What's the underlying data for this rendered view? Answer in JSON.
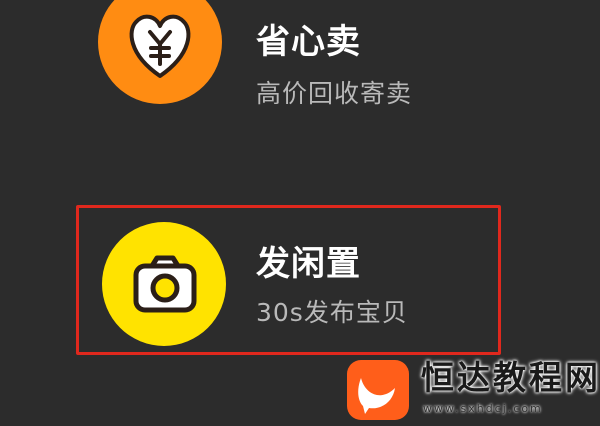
{
  "menu": {
    "items": [
      {
        "title": "省心卖",
        "subtitle": "高价回收寄卖",
        "icon": "heart-yuan-icon",
        "color": "#ff8c12"
      },
      {
        "title": "发闲置",
        "subtitle": "30s发布宝贝",
        "icon": "camera-icon",
        "color": "#ffe300"
      }
    ]
  },
  "highlight": {
    "color": "#e0281d"
  },
  "watermark": {
    "site_name": "恒达教程网",
    "url": "www.sxhdcj.com",
    "logo_icon": "chat-bubble-logo-icon",
    "logo_color": "#ff5e1a"
  }
}
